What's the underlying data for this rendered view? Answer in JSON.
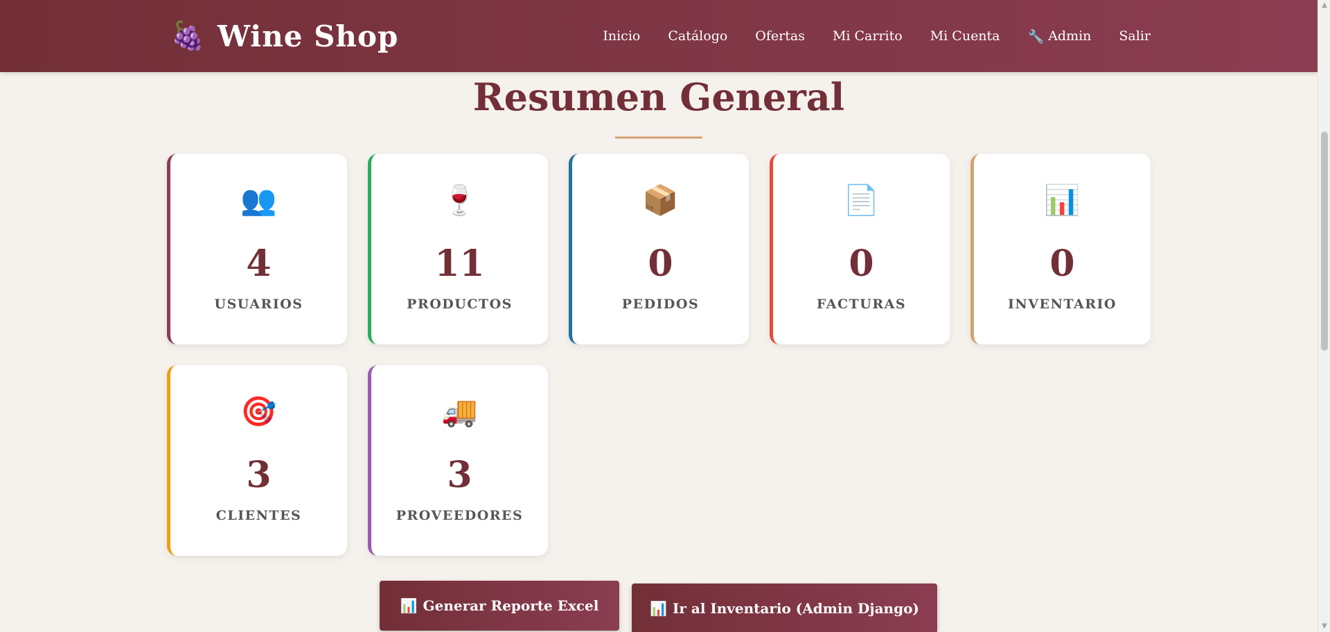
{
  "navbar": {
    "brand_icon": "🍇",
    "brand_name": "Wine Shop",
    "links": [
      {
        "label": "Inicio"
      },
      {
        "label": "Catálogo"
      },
      {
        "label": "Ofertas"
      },
      {
        "label": "Mi Carrito"
      },
      {
        "label": "Mi Cuenta"
      },
      {
        "label": "Admin",
        "icon": "🔧"
      },
      {
        "label": "Salir"
      }
    ]
  },
  "page": {
    "title": "Resumen General"
  },
  "stats": [
    {
      "icon": "👥",
      "icon_name": "users-icon",
      "value": "4",
      "label": "USUARIOS",
      "accent": "#8b3d52"
    },
    {
      "icon": "🍷",
      "icon_name": "wine-glass-icon",
      "value": "11",
      "label": "PRODUCTOS",
      "accent": "#27ae60"
    },
    {
      "icon": "📦",
      "icon_name": "package-icon",
      "value": "0",
      "label": "PEDIDOS",
      "accent": "#2471a3"
    },
    {
      "icon": "📄",
      "icon_name": "document-icon",
      "value": "0",
      "label": "FACTURAS",
      "accent": "#e74c3c"
    },
    {
      "icon": "📊",
      "icon_name": "bar-chart-icon",
      "value": "0",
      "label": "INVENTARIO",
      "accent": "#d4a373"
    },
    {
      "icon": "🎯",
      "icon_name": "target-icon",
      "value": "3",
      "label": "CLIENTES",
      "accent": "#f39c12"
    },
    {
      "icon": "🚚",
      "icon_name": "truck-icon",
      "value": "3",
      "label": "PROVEEDORES",
      "accent": "#9b59b6"
    }
  ],
  "actions": {
    "report_icon": "📊",
    "report_label": "Generar Reporte Excel",
    "inventory_icon": "📊",
    "inventory_label": "Ir al Inventario (Admin Django)"
  },
  "colors": {
    "brand": "#722f37",
    "brand_light": "#8b3d52",
    "accent_gold": "#d4a373",
    "background": "#f5f1ec"
  },
  "scrollbar": {
    "up_icon": "▲",
    "down_icon": "▼"
  }
}
